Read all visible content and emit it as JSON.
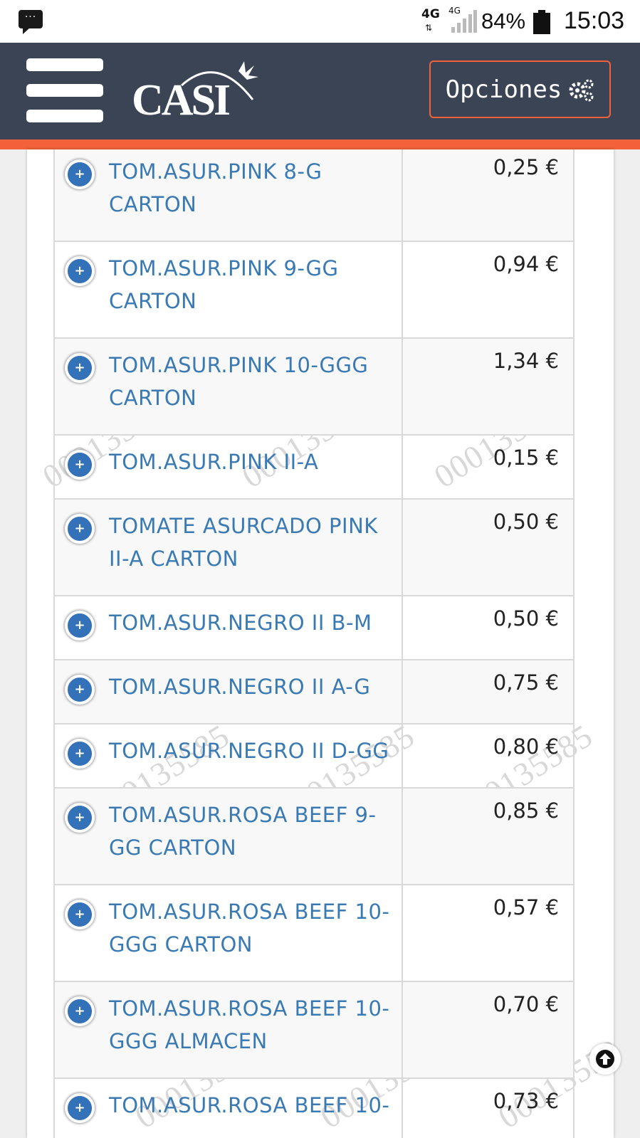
{
  "status_bar": {
    "network_primary": "4G",
    "network_secondary": "4G",
    "battery": "84%",
    "time": "15:03"
  },
  "header": {
    "logo_text": "CASI",
    "options_label": "Opciones",
    "colors": {
      "bar": "#3b4454",
      "accent": "#f2613a"
    }
  },
  "watermark_text": "000135585",
  "products": [
    {
      "name": "TOM.ASUR.PINK 8-G CARTON",
      "price": "0,25 €"
    },
    {
      "name": "TOM.ASUR.PINK 9-GG CARTON",
      "price": "0,94 €"
    },
    {
      "name": "TOM.ASUR.PINK 10-GGG CARTON",
      "price": "1,34 €"
    },
    {
      "name": "TOM.ASUR.PINK II-A",
      "price": "0,15 €"
    },
    {
      "name": "TOMATE ASURCADO PINK II-A CARTON",
      "price": "0,50 €"
    },
    {
      "name": "TOM.ASUR.NEGRO II B-M",
      "price": "0,50 €"
    },
    {
      "name": "TOM.ASUR.NEGRO II A-G",
      "price": "0,75 €"
    },
    {
      "name": "TOM.ASUR.NEGRO II D-GG",
      "price": "0,80 €"
    },
    {
      "name": "TOM.ASUR.ROSA BEEF 9-GG CARTON",
      "price": "0,85 €"
    },
    {
      "name": "TOM.ASUR.ROSA BEEF 10-GGG CARTON",
      "price": "0,57 €"
    },
    {
      "name": "TOM.ASUR.ROSA BEEF 10-GGG ALMACEN",
      "price": "0,70 €"
    },
    {
      "name": "TOM.ASUR.ROSA BEEF 10-",
      "price": "0,73 €"
    }
  ],
  "icons": {
    "expand": "plus-circle-icon",
    "options": "gears-icon",
    "scroll_top": "arrow-up-circle-icon"
  }
}
